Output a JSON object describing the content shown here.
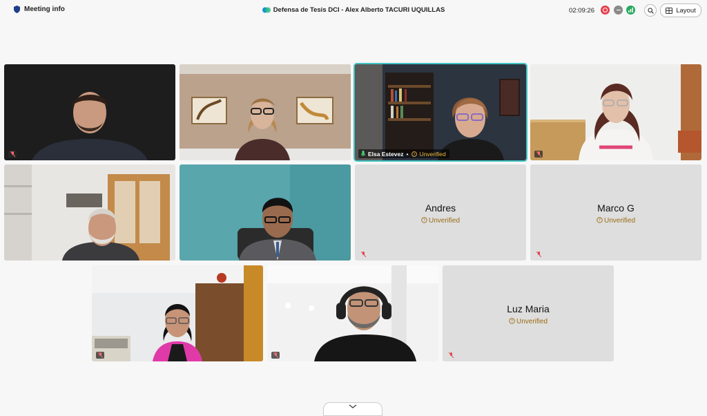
{
  "topbar": {
    "meeting_info_label": "Meeting info",
    "meeting_title": "Defensa de Tesis DCI - Alex Alberto TACURI UQUILLAS",
    "elapsed_time": "02:09:26",
    "layout_label": "Layout",
    "colors": {
      "record": "#e5404d",
      "cc": "#8a8a8a",
      "signal": "#27a95e"
    }
  },
  "participants": [
    {
      "tile": "video",
      "muted": true
    },
    {
      "tile": "video",
      "muted": false
    },
    {
      "tile": "video",
      "muted": false,
      "active_speaker": true,
      "name": "Elsa Estevez",
      "status": "Unverified"
    },
    {
      "tile": "video",
      "muted": true
    },
    {
      "tile": "video",
      "muted": false
    },
    {
      "tile": "video",
      "muted": false
    },
    {
      "tile": "avatar",
      "muted": true,
      "name": "Andres",
      "status": "Unverified"
    },
    {
      "tile": "avatar",
      "muted": true,
      "name": "Marco G",
      "status": "Unverified"
    },
    {
      "tile": "video",
      "muted": true
    },
    {
      "tile": "video",
      "muted": true
    },
    {
      "tile": "avatar",
      "muted": true,
      "name": "Luz Maria",
      "status": "Unverified"
    }
  ],
  "accent": {
    "active_speaker_border": "#41c3c3",
    "unverified_text": "#9a6b13"
  },
  "icons": [
    "shield-icon",
    "webex-logo-icon",
    "record-icon",
    "captions-icon",
    "signal-icon",
    "zoom-icon",
    "layout-grid-icon",
    "mic-muted-icon",
    "mic-icon",
    "info-circle-icon",
    "chevron-down-icon"
  ]
}
